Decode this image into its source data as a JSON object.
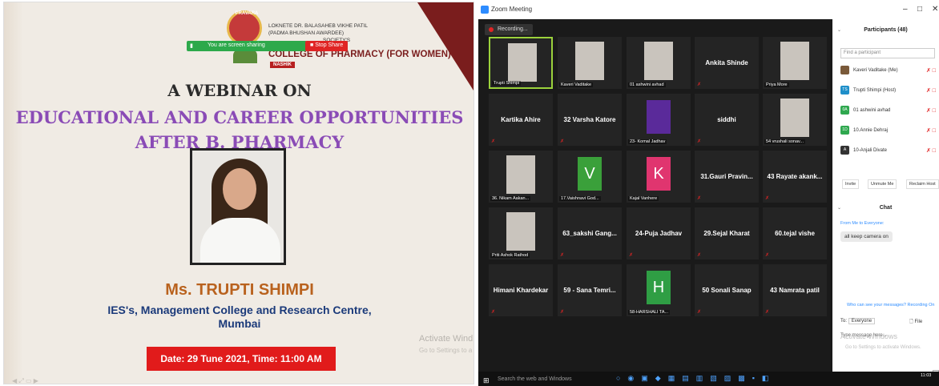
{
  "slide": {
    "logo_text": "PRAVARA",
    "institution_lines": [
      "LOKNETE DR. BALASAHEB VIKHE PATIL",
      "(PADMA BHUSHAN AWARDEE)",
      "SOCIETY'S"
    ],
    "college": "COLLEGE OF PHARMACY (FOR WOMEN)",
    "city": "NASHIK",
    "screen_share_text": "You are screen sharing",
    "stop_share_label": "Stop Share",
    "webinar_heading": "A WEBINAR ON",
    "topic_line1": "EDUCATIONAL AND CAREER OPPORTUNITIES",
    "topic_line2": "AFTER B. PHARMACY",
    "speaker": "Ms. TRUPTI SHIMPI",
    "affiliation_line1": "IES's, Management College and Research Centre,",
    "affiliation_line2": "Mumbai",
    "date_time": "Date: 29 Tune 2021, Time: 11:00 AM",
    "activate_title": "Activate Wind",
    "activate_sub": "Go to Settings to a"
  },
  "zoom": {
    "window_title": "Zoom Meeting",
    "recording_label": "Recording...",
    "window_controls": [
      "–",
      "□",
      "✕"
    ],
    "tiles": [
      {
        "type": "video",
        "label": "Trupti Shimpi",
        "active": true
      },
      {
        "type": "video",
        "label": "Kaveri Vaditake"
      },
      {
        "type": "video",
        "label": "01 ashwini avhad"
      },
      {
        "type": "name",
        "name": "Ankita Shinde"
      },
      {
        "type": "video",
        "label": "Priya More"
      },
      {
        "type": "name",
        "name": "Kartika Ahire"
      },
      {
        "type": "name",
        "name": "32 Varsha Katore"
      },
      {
        "type": "avatar",
        "letter": "",
        "color": "#5a2a9a",
        "label": "23- Komal Jadhav"
      },
      {
        "type": "name",
        "name": "siddhi"
      },
      {
        "type": "video",
        "label": "54 vrushali sonav..."
      },
      {
        "type": "video",
        "label": "36. Nikam Aakan..."
      },
      {
        "type": "avatar",
        "letter": "V",
        "color": "#3aa03a",
        "label": "17.Vaishnavi God..."
      },
      {
        "type": "avatar",
        "letter": "K",
        "color": "#e0356f",
        "label": "Kajal Vanhere"
      },
      {
        "type": "name",
        "name": "31.Gauri Pravin..."
      },
      {
        "type": "name",
        "name": "43 Rayate akank..."
      },
      {
        "type": "video",
        "label": "Priti Ashok Rathod"
      },
      {
        "type": "name",
        "name": "63_sakshi Gang..."
      },
      {
        "type": "name",
        "name": "24-Puja Jadhav"
      },
      {
        "type": "name",
        "name": "29.Sejal Kharat"
      },
      {
        "type": "name",
        "name": "60.tejal vishe"
      },
      {
        "type": "name",
        "name": "Himani Khardekar"
      },
      {
        "type": "name",
        "name": "59 - Sana Temri..."
      },
      {
        "type": "avatar",
        "letter": "H",
        "color": "#2f9e44",
        "label": "58-HARSHALI TA..."
      },
      {
        "type": "name",
        "name": "50 Sonali Sanap"
      },
      {
        "type": "name",
        "name": "43 Namrata patil"
      }
    ],
    "participants_title": "Participants (48)",
    "find_placeholder": "Find a participant",
    "participants": [
      {
        "initials": "",
        "name": "Kaveri Vaditake (Me)",
        "color": "#7a5a3a"
      },
      {
        "initials": "TS",
        "name": "Trupti Shimpi (Host)",
        "color": "#1f8fc9"
      },
      {
        "initials": "0A",
        "name": "01 ashwini avhad",
        "color": "#2fa84f"
      },
      {
        "initials": "1D",
        "name": "10.Annie Dehraj",
        "color": "#2fa84f"
      },
      {
        "initials": "A",
        "name": "10-Anjali Divate",
        "color": "#333333"
      }
    ],
    "panel_buttons": [
      "Invite",
      "Unmute Me",
      "Reclaim Host"
    ],
    "chat_title": "Chat",
    "chat_from": "From Me to Everyone:",
    "chat_message": "all keep camera on",
    "who_can_see": "Who can see your messages? Recording On",
    "to_label": "To:",
    "to_value": "Everyone",
    "file_label": "File",
    "type_message": "Type message here...",
    "activate_title": "Activate Windows",
    "activate_sub": "Go to Settings to activate Windows.",
    "date_popup": "29 June 2 Tuesday",
    "taskbar_search": "Search the web and Windows",
    "clock": "11:03"
  }
}
